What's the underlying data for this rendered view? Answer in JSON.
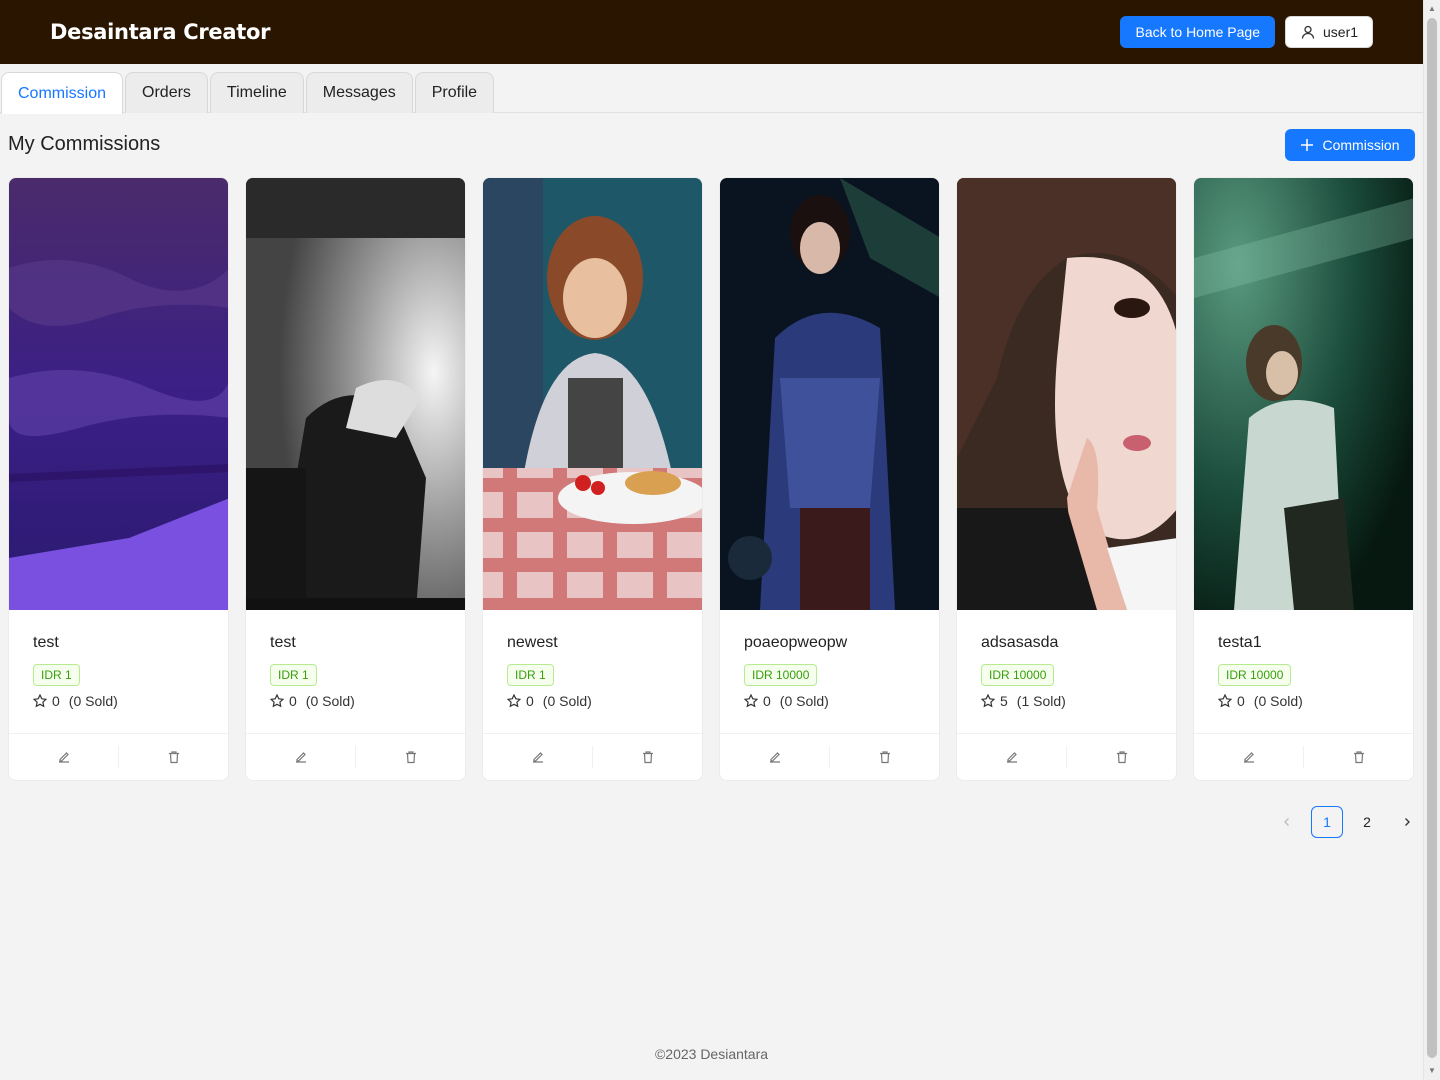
{
  "header": {
    "brand": "Desaintara Creator",
    "home_button": "Back to Home Page",
    "user_button": "user1"
  },
  "tabs": [
    {
      "label": "Commission",
      "active": true
    },
    {
      "label": "Orders",
      "active": false
    },
    {
      "label": "Timeline",
      "active": false
    },
    {
      "label": "Messages",
      "active": false
    },
    {
      "label": "Profile",
      "active": false
    }
  ],
  "section": {
    "title": "My Commissions",
    "add_button": "Commission"
  },
  "cards": [
    {
      "title": "test",
      "price": "IDR 1",
      "rating": "0",
      "sold": "(0 Sold)",
      "image": "purple-landscape-photo"
    },
    {
      "title": "test",
      "price": "IDR 1",
      "rating": "0",
      "sold": "(0 Sold)",
      "image": "black-white-stage-photo"
    },
    {
      "title": "newest",
      "price": "IDR 1",
      "rating": "0",
      "sold": "(0 Sold)",
      "image": "woman-at-table-photo"
    },
    {
      "title": "poaeopweopw",
      "price": "IDR 10000",
      "rating": "0",
      "sold": "(0 Sold)",
      "image": "singer-on-stage-photo"
    },
    {
      "title": "adsasasda",
      "price": "IDR 10000",
      "rating": "5",
      "sold": "(1 Sold)",
      "image": "portrait-closeup-photo"
    },
    {
      "title": "testa1",
      "price": "IDR 10000",
      "rating": "0",
      "sold": "(0 Sold)",
      "image": "green-stage-light-photo"
    }
  ],
  "pagination": {
    "pages": [
      "1",
      "2"
    ],
    "current": "1"
  },
  "footer": "©2023 Desiantara",
  "colors": {
    "header_bg": "#2a1600",
    "accent": "#1677ff",
    "tag_green": "#389e0d"
  }
}
